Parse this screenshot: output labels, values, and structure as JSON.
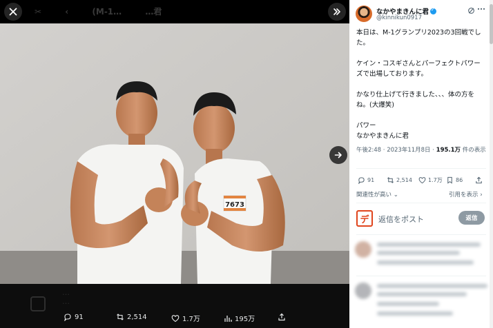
{
  "media": {
    "ghost_header": [
      "✂",
      "‹",
      "(M-1…",
      "…君"
    ],
    "shirt_number": "7673",
    "actions": {
      "replies": "91",
      "reposts": "2,514",
      "likes": "1.7万",
      "views": "195万"
    },
    "ghost_lines": [
      "…",
      "…"
    ]
  },
  "tweet": {
    "author_name": "なかやまきんに君",
    "author_handle": "@kinnikun0917",
    "body": [
      "本日は、M-1グランプリ2023の3回戦でした。",
      "ケイン・コスギさんとパーフェクトパワーズで出場しております。",
      "かなり仕上げて行きました、、、体の方をね。(大爆笑)",
      "パワー\nなかやまきんに君"
    ],
    "time": "午後2:48 · 2023年11月8日 · ",
    "views_count": "195.1万",
    "views_suffix": " 件の表示",
    "stats": {
      "replies": "91",
      "reposts": "2,514",
      "likes": "1.7万",
      "bookmarks": "86"
    },
    "related_link": "関連性が高い ⌄",
    "quotes_link": "引用を表示 ›",
    "reply_avatar_char": "デ",
    "reply_placeholder": "返信をポスト",
    "reply_button": "返信"
  },
  "colors": {
    "accent": "#1d9bf0",
    "reply_avatar_border": "#e0441c",
    "reply_button_disabled": "#8e9aa3"
  }
}
